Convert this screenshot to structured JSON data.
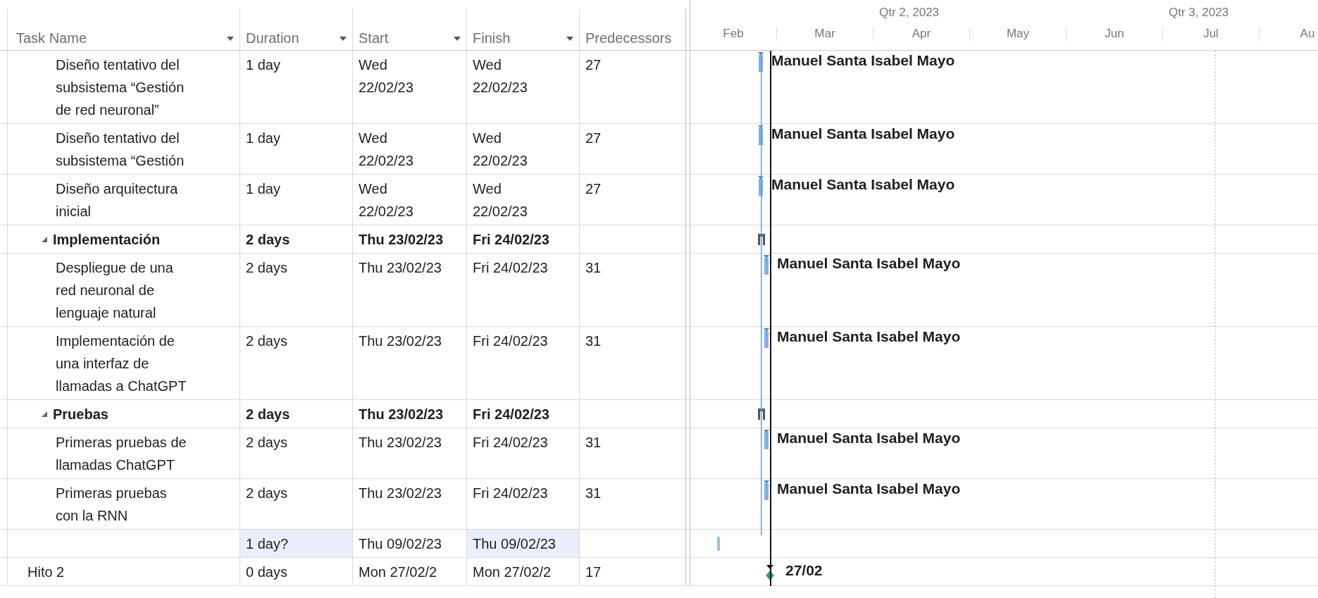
{
  "columns": [
    {
      "label": "Task Name",
      "filter": true
    },
    {
      "label": "Duration",
      "filter": true
    },
    {
      "label": "Start",
      "filter": true
    },
    {
      "label": "Finish",
      "filter": true
    },
    {
      "label": "Predecessors",
      "filter": false
    }
  ],
  "timescale": {
    "quarters": [
      "Qtr 2, 2023",
      "Qtr 3, 2023"
    ],
    "months": [
      "Feb",
      "Mar",
      "Apr",
      "May",
      "Jun",
      "Jul",
      "Au"
    ]
  },
  "continued_tasks": [
    {
      "kind": "task",
      "name": "Diseño tentativo del subsistema “Gestión de red neuronal”",
      "duration": "1 day",
      "start": "Wed 22/02/23",
      "finish": "Wed 22/02/23",
      "predecessors": "27",
      "resource": "Manuel Santa Isabel Mayo"
    },
    {
      "kind": "task",
      "name": "Diseño tentativo del subsistema “Gestión",
      "duration": "1 day",
      "start": "Wed 22/02/23",
      "finish": "Wed 22/02/23",
      "predecessors": "27",
      "resource": "Manuel Santa Isabel Mayo"
    },
    {
      "kind": "task",
      "name": "Diseño arquitectura inicial",
      "duration": "1 day",
      "start": "Wed 22/02/23",
      "finish": "Wed 22/02/23",
      "predecessors": "27",
      "resource": "Manuel Santa Isabel Mayo"
    }
  ],
  "rows": [
    {
      "kind": "summary",
      "name": "Implementación",
      "expanded": true,
      "duration": "2 days",
      "start": "Thu 23/02/23",
      "finish": "Fri 24/02/23",
      "children": [
        {
          "kind": "task",
          "name": "Despliegue de una red neuronal de lenguaje natural",
          "duration": "2 days",
          "start": "Thu 23/02/23",
          "finish": "Fri 24/02/23",
          "predecessors": "31",
          "resource": "Manuel Santa Isabel Mayo"
        },
        {
          "kind": "task",
          "name": "Implementación de una interfaz de llamadas a ChatGPT",
          "duration": "2 days",
          "start": "Thu 23/02/23",
          "finish": "Fri 24/02/23",
          "predecessors": "31",
          "resource": "Manuel Santa Isabel Mayo"
        }
      ]
    },
    {
      "kind": "summary",
      "name": "Pruebas",
      "expanded": true,
      "duration": "2 days",
      "start": "Thu 23/02/23",
      "finish": "Fri 24/02/23",
      "children": [
        {
          "kind": "task",
          "name": "Primeras pruebas de llamadas ChatGPT",
          "duration": "2 days",
          "start": "Thu 23/02/23",
          "finish": "Fri 24/02/23",
          "predecessors": "31",
          "resource": "Manuel Santa Isabel Mayo"
        },
        {
          "kind": "task",
          "name": "Primeras pruebas con la RNN",
          "duration": "2 days",
          "start": "Thu 23/02/23",
          "finish": "Fri 24/02/23",
          "predecessors": "31",
          "resource": "Manuel Santa Isabel Mayo"
        }
      ]
    },
    {
      "kind": "blank",
      "duration": "1 day?",
      "start": "Thu 09/02/23",
      "finish": "Thu 09/02/23",
      "duration_highlighted": true,
      "finish_highlighted": true
    },
    {
      "kind": "milestone",
      "name": "Hito 2",
      "duration": "0 days",
      "start": "Mon 27/02/2",
      "finish": "Mon 27/02/2",
      "predecessors": "17",
      "date_label": "27/02"
    }
  ]
}
